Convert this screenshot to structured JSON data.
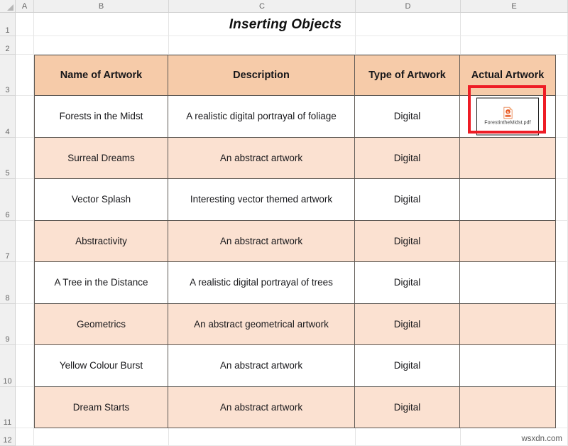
{
  "sheet": {
    "title": "Inserting Objects",
    "column_headers": [
      "A",
      "B",
      "C",
      "D",
      "E"
    ],
    "row_headers": [
      "1",
      "2",
      "3",
      "4",
      "5",
      "6",
      "7",
      "8",
      "9",
      "10",
      "11",
      "12"
    ]
  },
  "table": {
    "headers": [
      "Name of Artwork",
      "Description",
      "Type of Artwork",
      "Actual Artwork"
    ],
    "rows": [
      {
        "name": "Forests in the Midst",
        "description": "A realistic digital portrayal of  foliage",
        "type": "Digital",
        "artwork": "ForestintheMidst.pdf"
      },
      {
        "name": "Surreal Dreams",
        "description": "An abstract artwork",
        "type": "Digital",
        "artwork": ""
      },
      {
        "name": "Vector Splash",
        "description": "Interesting vector themed artwork",
        "type": "Digital",
        "artwork": ""
      },
      {
        "name": "Abstractivity",
        "description": "An abstract artwork",
        "type": "Digital",
        "artwork": ""
      },
      {
        "name": "A Tree in the Distance",
        "description": "A realistic digital portrayal of trees",
        "type": "Digital",
        "artwork": ""
      },
      {
        "name": "Geometrics",
        "description": "An abstract geometrical artwork",
        "type": "Digital",
        "artwork": ""
      },
      {
        "name": "Yellow Colour Burst",
        "description": "An abstract artwork",
        "type": "Digital",
        "artwork": ""
      },
      {
        "name": "Dream Starts",
        "description": "An abstract artwork",
        "type": "Digital",
        "artwork": ""
      }
    ]
  },
  "embedded_object": {
    "filename": "ForestintheMidst.pdf",
    "icon": "pdf-file-icon"
  },
  "watermark": "wsxdn.com",
  "colors": {
    "header_fill": "#F6CBA9",
    "banded_row_fill": "#FBE1D1",
    "plain_row_fill": "#FFFFFF",
    "table_border": "#5D5853",
    "annotation": "#EE1C25",
    "pdf_icon": "#E8561E"
  }
}
